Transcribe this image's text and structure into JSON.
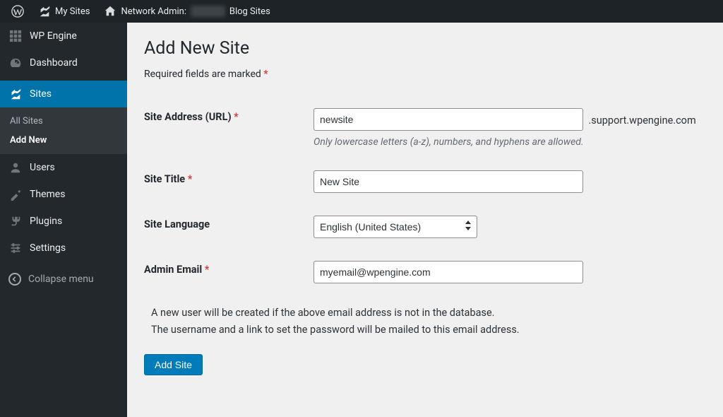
{
  "topbar": {
    "my_sites_label": "My Sites",
    "network_admin_prefix": "Network Admin:",
    "network_admin_obscured": "████",
    "network_admin_suffix": "Blog Sites"
  },
  "sidebar": {
    "items": [
      {
        "name": "wp-engine",
        "label": "WP Engine"
      },
      {
        "name": "dashboard",
        "label": "Dashboard"
      },
      {
        "name": "sites",
        "label": "Sites"
      },
      {
        "name": "users",
        "label": "Users"
      },
      {
        "name": "themes",
        "label": "Themes"
      },
      {
        "name": "plugins",
        "label": "Plugins"
      },
      {
        "name": "settings",
        "label": "Settings"
      }
    ],
    "sites_submenu": {
      "all_sites": "All Sites",
      "add_new": "Add New"
    },
    "collapse_label": "Collapse menu"
  },
  "page": {
    "title": "Add New Site",
    "required_note_prefix": "Required fields are marked",
    "submit_label": "Add Site",
    "hint_line1": "A new user will be created if the above email address is not in the database.",
    "hint_line2": "The username and a link to set the password will be mailed to this email address."
  },
  "fields": {
    "site_address": {
      "label": "Site Address (URL)",
      "required": true,
      "value": "newsite",
      "domain_suffix": ".support.wpengine.com",
      "description": "Only lowercase letters (a-z), numbers, and hyphens are allowed."
    },
    "site_title": {
      "label": "Site Title",
      "required": true,
      "value": "New Site"
    },
    "site_language": {
      "label": "Site Language",
      "required": false,
      "value": "English (United States)"
    },
    "admin_email": {
      "label": "Admin Email",
      "required": true,
      "value": "myemail@wpengine.com"
    }
  }
}
